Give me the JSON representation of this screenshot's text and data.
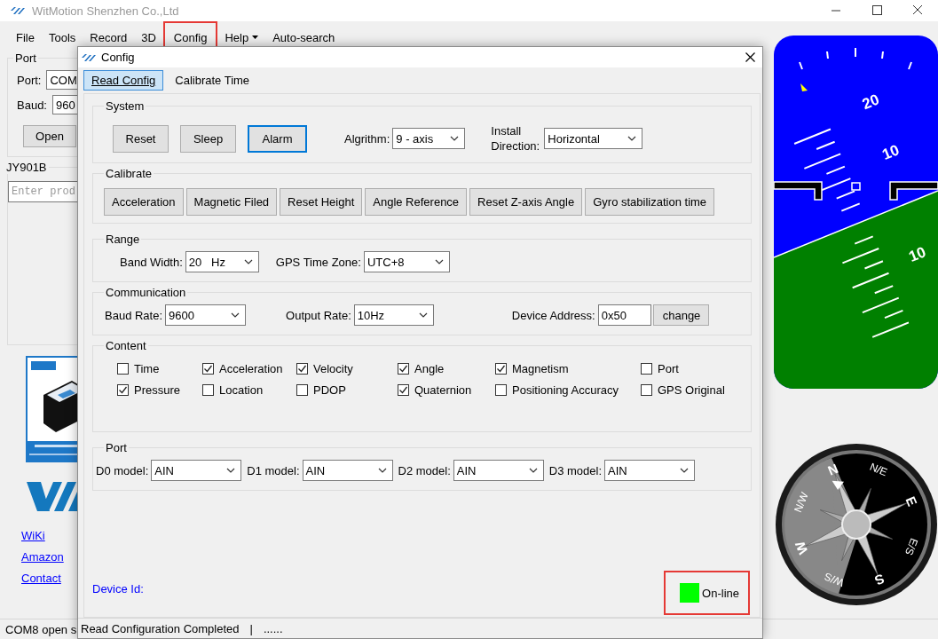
{
  "main_window": {
    "title": "WitMotion Shenzhen Co.,Ltd",
    "menu": [
      {
        "label": "File",
        "kind": "plain",
        "highlighted": false
      },
      {
        "label": "Tools",
        "kind": "plain",
        "highlighted": false
      },
      {
        "label": "Record",
        "kind": "plain",
        "highlighted": false
      },
      {
        "label": "3D",
        "kind": "plain",
        "highlighted": false
      },
      {
        "label": "Config",
        "kind": "plain",
        "highlighted": true
      },
      {
        "label": "Help",
        "kind": "dropdown",
        "highlighted": false
      },
      {
        "label": "Auto-search",
        "kind": "plain",
        "highlighted": false
      }
    ],
    "port_group": {
      "title": "Port",
      "port_label": "Port:",
      "port_value": "COM",
      "baud_label": "Baud:",
      "baud_value": "960",
      "open_button": "Open"
    },
    "device_group": {
      "title": "JY901B",
      "placeholder": "Enter prod"
    },
    "links": [
      "WiKi",
      "Amazon",
      "Contact"
    ],
    "status_bar": "COM8 open s"
  },
  "config_dialog": {
    "title": "Config",
    "tabs": [
      {
        "label": "Read Config",
        "selected": true
      },
      {
        "label": "Calibrate Time",
        "selected": false
      }
    ],
    "system": {
      "title": "System",
      "buttons": [
        {
          "label": "Reset",
          "focused": false
        },
        {
          "label": "Sleep",
          "focused": false
        },
        {
          "label": "Alarm",
          "focused": true
        }
      ],
      "algorithm_label": "Algrithm:",
      "algorithm_value": "9 - axis",
      "install_label": "Install Direction:",
      "install_value": "Horizontal"
    },
    "calibrate": {
      "title": "Calibrate",
      "buttons": [
        "Acceleration",
        "Magnetic Filed",
        "Reset Height",
        "Angle Reference",
        "Reset Z-axis Angle",
        "Gyro stabilization time"
      ]
    },
    "range": {
      "title": "Range",
      "band_label": "Band Width:",
      "band_value": "20   Hz",
      "timezone_label": "GPS Time Zone:",
      "timezone_value": "UTC+8"
    },
    "communication": {
      "title": "Communication",
      "baud_label": "Baud Rate:",
      "baud_value": "9600",
      "output_label": "Output Rate:",
      "output_value": "10Hz",
      "address_label": "Device Address:",
      "address_value": "0x50",
      "change_button": "change"
    },
    "content": {
      "title": "Content",
      "items": [
        {
          "label": "Time",
          "checked": false
        },
        {
          "label": "Acceleration",
          "checked": true
        },
        {
          "label": "Velocity",
          "checked": true
        },
        {
          "label": "Angle",
          "checked": true
        },
        {
          "label": "Magnetism",
          "checked": true
        },
        {
          "label": "Port",
          "checked": false
        },
        {
          "label": "Pressure",
          "checked": true
        },
        {
          "label": "Location",
          "checked": false
        },
        {
          "label": "PDOP",
          "checked": false
        },
        {
          "label": "Quaternion",
          "checked": true
        },
        {
          "label": "Positioning Accuracy",
          "checked": false
        },
        {
          "label": "GPS Original",
          "checked": false
        }
      ]
    },
    "port": {
      "title": "Port",
      "models": [
        {
          "label": "D0 model:",
          "value": "AIN"
        },
        {
          "label": "D1 model:",
          "value": "AIN"
        },
        {
          "label": "D2 model:",
          "value": "AIN"
        },
        {
          "label": "D3 model:",
          "value": "AIN"
        }
      ]
    },
    "device_id_label": "Device Id:",
    "online": {
      "label": "On-line",
      "color": "#00ff00",
      "highlighted": true
    },
    "status_bar": [
      "Read Configuration Completed",
      "|",
      "......"
    ]
  },
  "attitude": {
    "labels": [
      "20",
      "10",
      "10"
    ]
  },
  "compass": {
    "labels": [
      "N",
      "N/E",
      "E",
      "E/S",
      "S",
      "W/S",
      "W",
      "N/W"
    ]
  }
}
